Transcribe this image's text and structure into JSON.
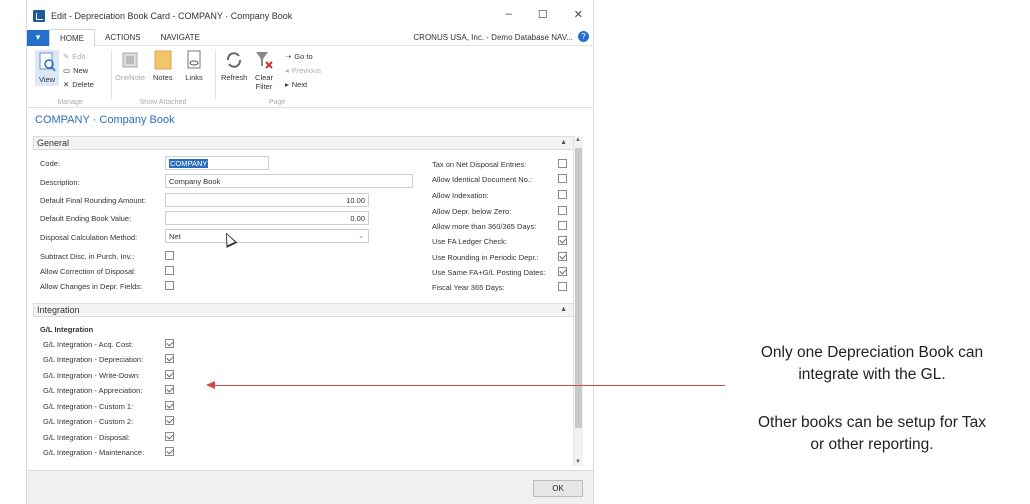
{
  "window": {
    "title": "Edit - Depreciation Book Card - COMPANY · Company Book",
    "controls": {
      "minimize": "–",
      "maximize": "☐",
      "close": "✕"
    }
  },
  "ribbon": {
    "tabs": [
      "HOME",
      "ACTIONS",
      "NAVIGATE"
    ],
    "company": "CRONUS USA, Inc. - Demo Database NAV...",
    "manage": {
      "label": "Manage",
      "view": "View",
      "edit": "Edit",
      "new": "New",
      "delete": "Delete"
    },
    "show_attached": {
      "label": "Show Attached",
      "onenote": "OneNote",
      "notes": "Notes",
      "links": "Links"
    },
    "page": {
      "label": "Page",
      "refresh": "Refresh",
      "clear_filter_1": "Clear",
      "clear_filter_2": "Filter",
      "goto": "Go to",
      "previous": "Previous",
      "next": "Next"
    }
  },
  "page_title": "COMPANY · Company Book",
  "general": {
    "header": "General",
    "code_label": "Code:",
    "code_value": "COMPANY",
    "description_label": "Description:",
    "description_value": "Company Book",
    "rounding_label": "Default Final Rounding Amount:",
    "rounding_value": "10.00",
    "ending_label": "Default Ending Book Value:",
    "ending_value": "0.00",
    "disposal_label": "Disposal Calculation Method:",
    "disposal_value": "Net",
    "left_checks": [
      {
        "label": "Subtract Disc. in Purch. Inv.:",
        "checked": false
      },
      {
        "label": "Allow Correction of Disposal:",
        "checked": false
      },
      {
        "label": "Allow Changes in Depr. Fields:",
        "checked": false
      }
    ],
    "right_checks": [
      {
        "label": "Tax on Net Disposal Entries:",
        "checked": false
      },
      {
        "label": "Allow Identical Document No.:",
        "checked": false
      },
      {
        "label": "Allow Indexation:",
        "checked": false
      },
      {
        "label": "Allow Depr. below Zero:",
        "checked": false
      },
      {
        "label": "Allow more than 360/365 Days:",
        "checked": false
      },
      {
        "label": "Use FA Ledger Check:",
        "checked": true
      },
      {
        "label": "Use Rounding in Periodic Depr.:",
        "checked": true
      },
      {
        "label": "Use Same FA+G/L Posting Dates:",
        "checked": true
      },
      {
        "label": "Fiscal Year 365 Days:",
        "checked": false
      }
    ]
  },
  "integration": {
    "header": "Integration",
    "subheader": "G/L Integration",
    "items": [
      {
        "label": "G/L Integration - Acq. Cost:",
        "checked": true
      },
      {
        "label": "G/L Integration - Depreciation:",
        "checked": true
      },
      {
        "label": "G/L Integration - Write-Down:",
        "checked": true
      },
      {
        "label": "G/L Integration - Appreciation:",
        "checked": true
      },
      {
        "label": "G/L Integration - Custom 1:",
        "checked": true
      },
      {
        "label": "G/L Integration - Custom 2:",
        "checked": true
      },
      {
        "label": "G/L Integration - Disposal:",
        "checked": true
      },
      {
        "label": "G/L Integration - Maintenance:",
        "checked": true
      }
    ]
  },
  "ok_label": "OK",
  "annotation": {
    "line1": "Only one Depreciation Book can",
    "line2": "integrate with the GL.",
    "line3": "Other books can be setup for Tax",
    "line4": "or other reporting.",
    "arrow_color": "#d04848"
  }
}
